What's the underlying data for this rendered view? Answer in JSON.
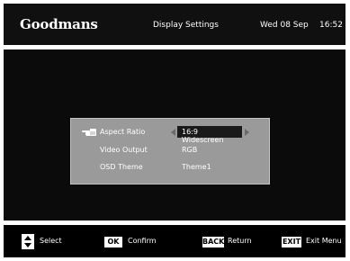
{
  "header": {
    "brand": "Goodmans",
    "title": "Display Settings",
    "date": "Wed 08 Sep",
    "time": "16:52"
  },
  "menu": {
    "items": [
      {
        "label": "Aspect Ratio",
        "value": "16:9 Widescreen",
        "selected": true
      },
      {
        "label": "Video Output",
        "value": "RGB",
        "selected": false
      },
      {
        "label": "OSD Theme",
        "value": "Theme1",
        "selected": false
      }
    ]
  },
  "footer": {
    "select_label": "Select",
    "ok_key": "OK",
    "confirm_label": "Confirm",
    "back_key": "BACK",
    "return_label": "Return",
    "exit_key": "EXIT",
    "exit_menu_label": "Exit Menu"
  },
  "icons": {
    "pointer": "pointing-hand-icon",
    "updown": "up-down-arrows-icon",
    "left_arrow": "left-arrow-icon",
    "right_arrow": "right-arrow-icon"
  },
  "colors": {
    "background": "#000000",
    "panel": "#9a9a9a",
    "selected_value_bg": "#1a1a1a",
    "text": "#ffffff",
    "key_bg": "#ffffff"
  }
}
